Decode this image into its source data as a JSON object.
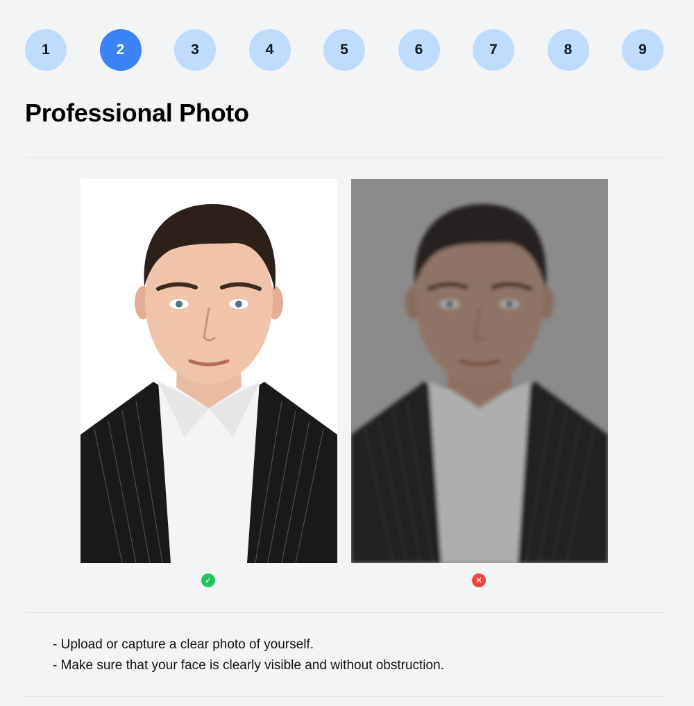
{
  "stepper": {
    "steps": [
      "1",
      "2",
      "3",
      "4",
      "5",
      "6",
      "7",
      "8",
      "9"
    ],
    "active_step": "2",
    "colors": {
      "inactive": "#bfdbfe",
      "active": "#3b82f6"
    }
  },
  "page": {
    "title": "Professional Photo"
  },
  "examples": {
    "good": {
      "status_icon": "check-circle-icon",
      "color": "#22c55e",
      "glyph": "✓"
    },
    "bad": {
      "status_icon": "x-circle-icon",
      "color": "#ef4444",
      "glyph": "✕"
    }
  },
  "instructions": [
    "- Upload or capture a clear photo of yourself.",
    "- Make sure that your face is clearly visible and without obstruction."
  ]
}
